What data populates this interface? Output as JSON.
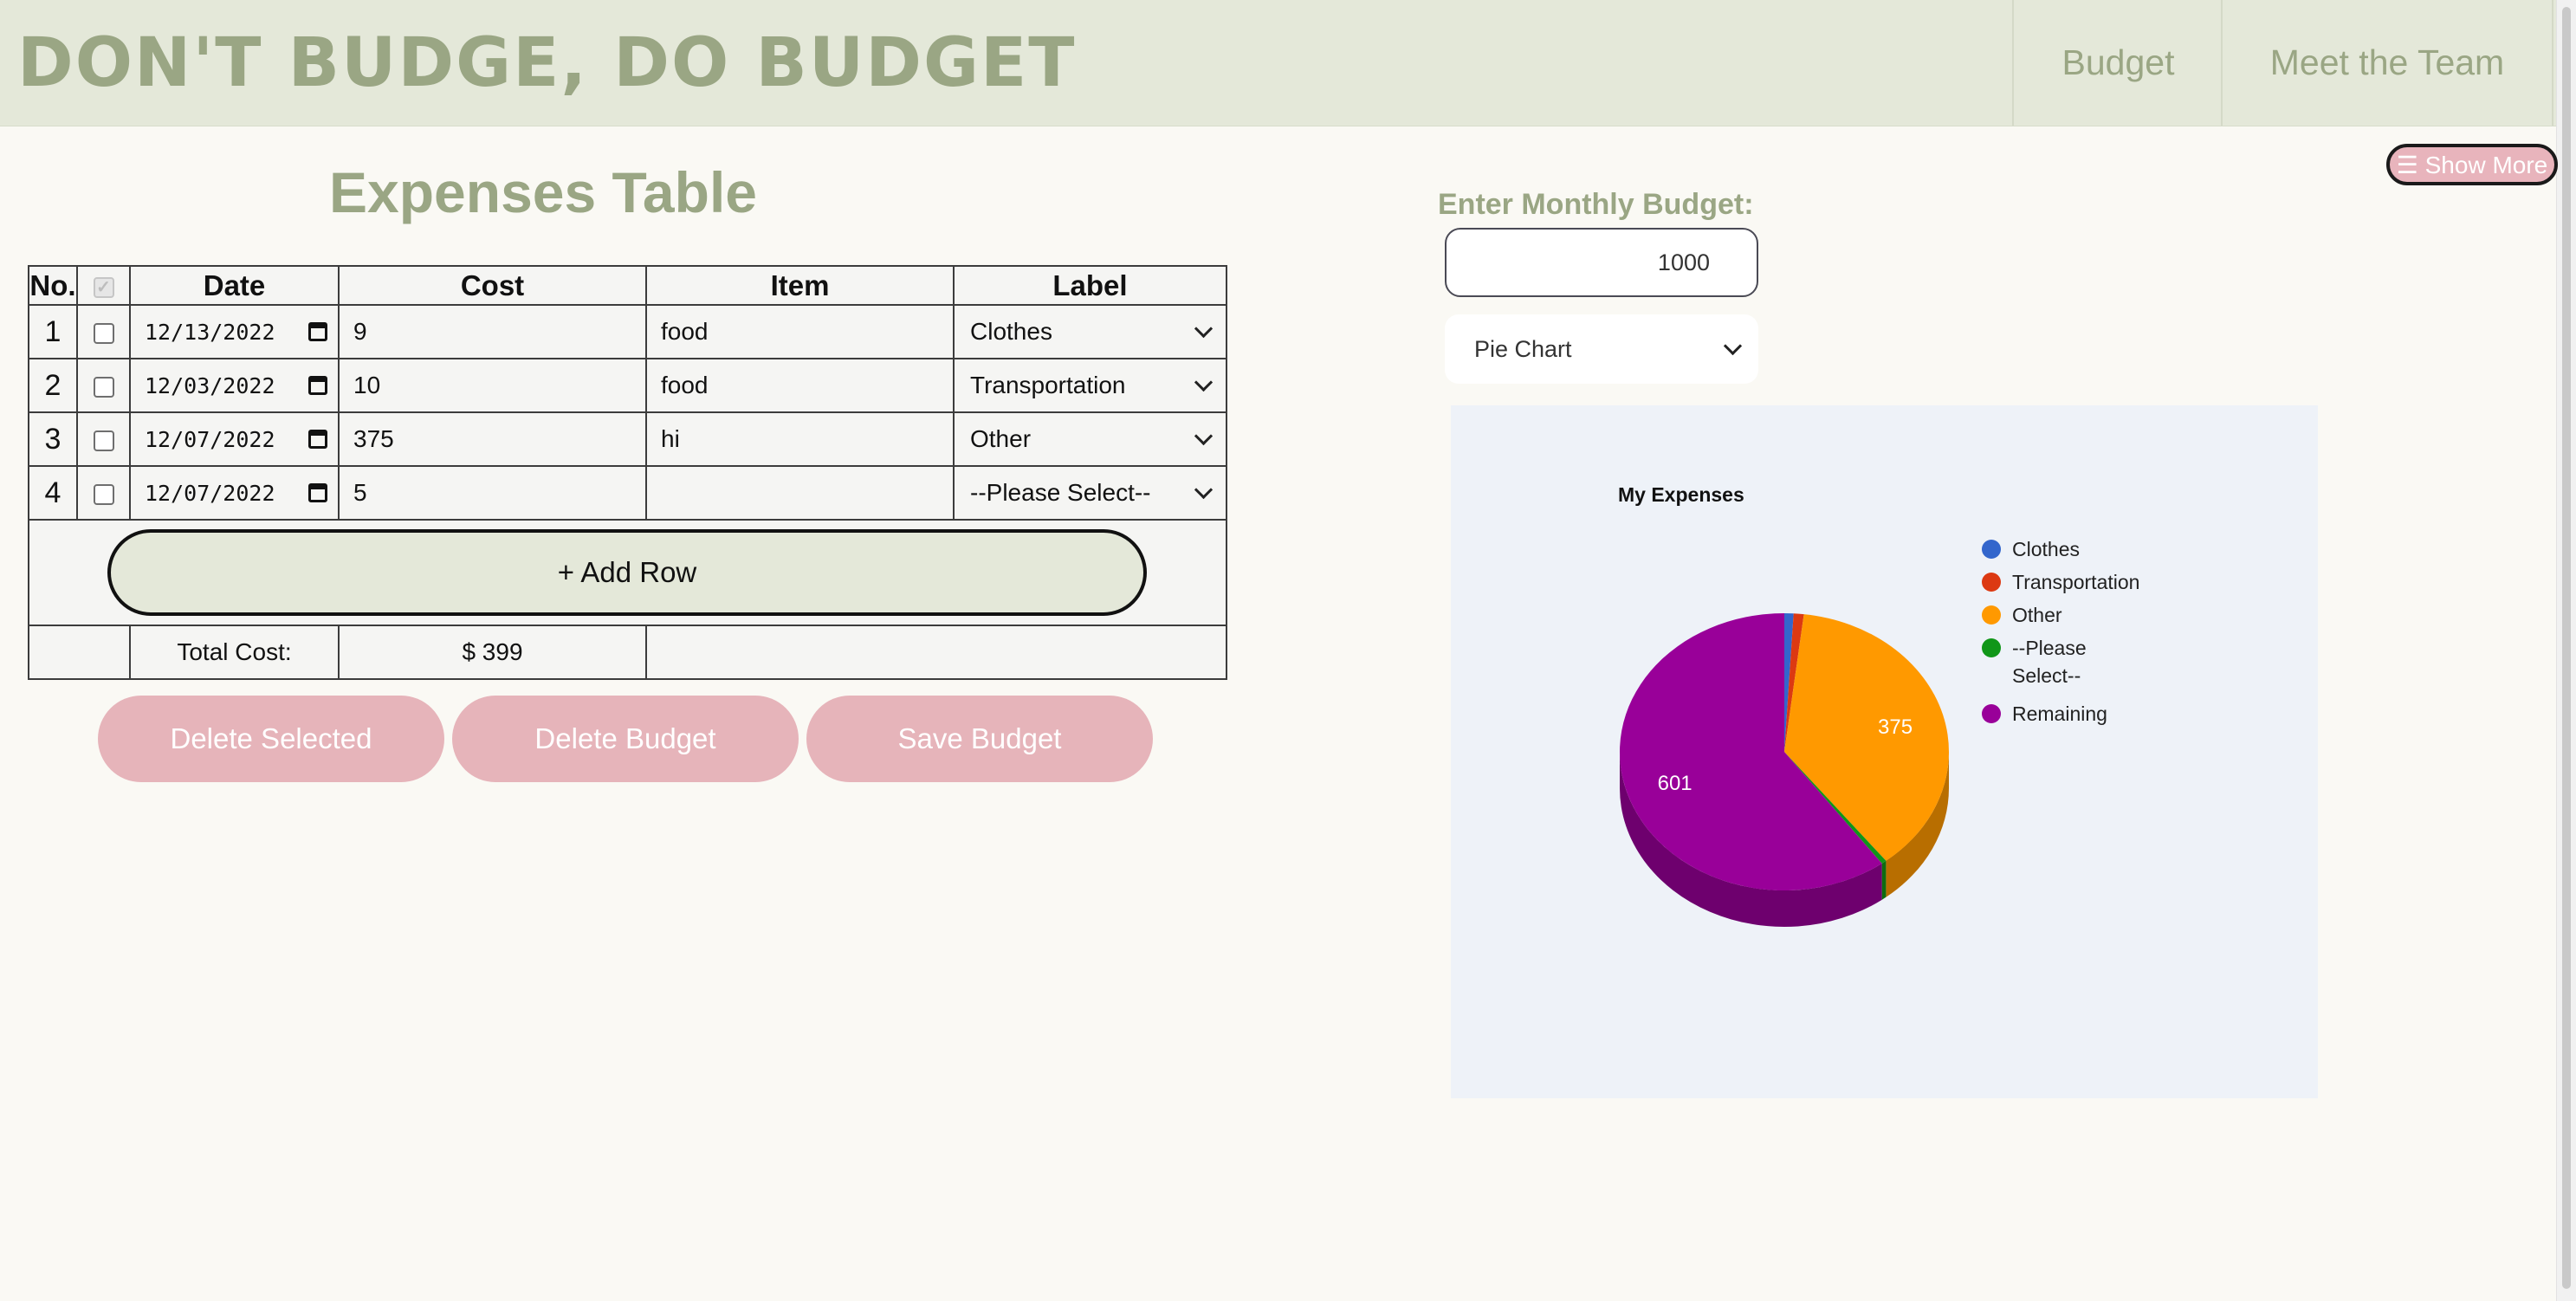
{
  "header": {
    "brand": "DON'T BUDGE, DO BUDGET",
    "nav": [
      "Budget",
      "Meet the Team"
    ]
  },
  "show_more": "☰ Show More",
  "expenses": {
    "title": "Expenses Table",
    "columns": [
      "No.",
      "",
      "Date",
      "Cost",
      "Item",
      "Label"
    ],
    "rows": [
      {
        "no": "1",
        "date": "12/13/2022",
        "cost": "9",
        "item": "food",
        "label": "Clothes"
      },
      {
        "no": "2",
        "date": "12/03/2022",
        "cost": "10",
        "item": "food",
        "label": "Transportation"
      },
      {
        "no": "3",
        "date": "12/07/2022",
        "cost": "375",
        "item": "hi",
        "label": "Other"
      },
      {
        "no": "4",
        "date": "12/07/2022",
        "cost": "5",
        "item": "",
        "label": "--Please Select--"
      }
    ],
    "add_row": "+ Add Row",
    "total_label": "Total Cost:",
    "total_value": "$ 399"
  },
  "actions": {
    "delete_selected": "Delete Selected",
    "delete_budget": "Delete Budget",
    "save_budget": "Save Budget"
  },
  "budget": {
    "label": "Enter Monthly Budget:",
    "value": "1000",
    "chart_type": "Pie Chart"
  },
  "chart_data": {
    "type": "pie",
    "title": "My Expenses",
    "categories": [
      "Clothes",
      "Transportation",
      "Other",
      "--Please Select--",
      "Remaining"
    ],
    "values": [
      9,
      10,
      375,
      5,
      601
    ],
    "colors": [
      "#3366cc",
      "#dc3912",
      "#ff9900",
      "#109618",
      "#990099"
    ],
    "data_labels": [
      "",
      "",
      "375",
      "",
      "601"
    ],
    "legend_position": "right",
    "style": "3d"
  }
}
